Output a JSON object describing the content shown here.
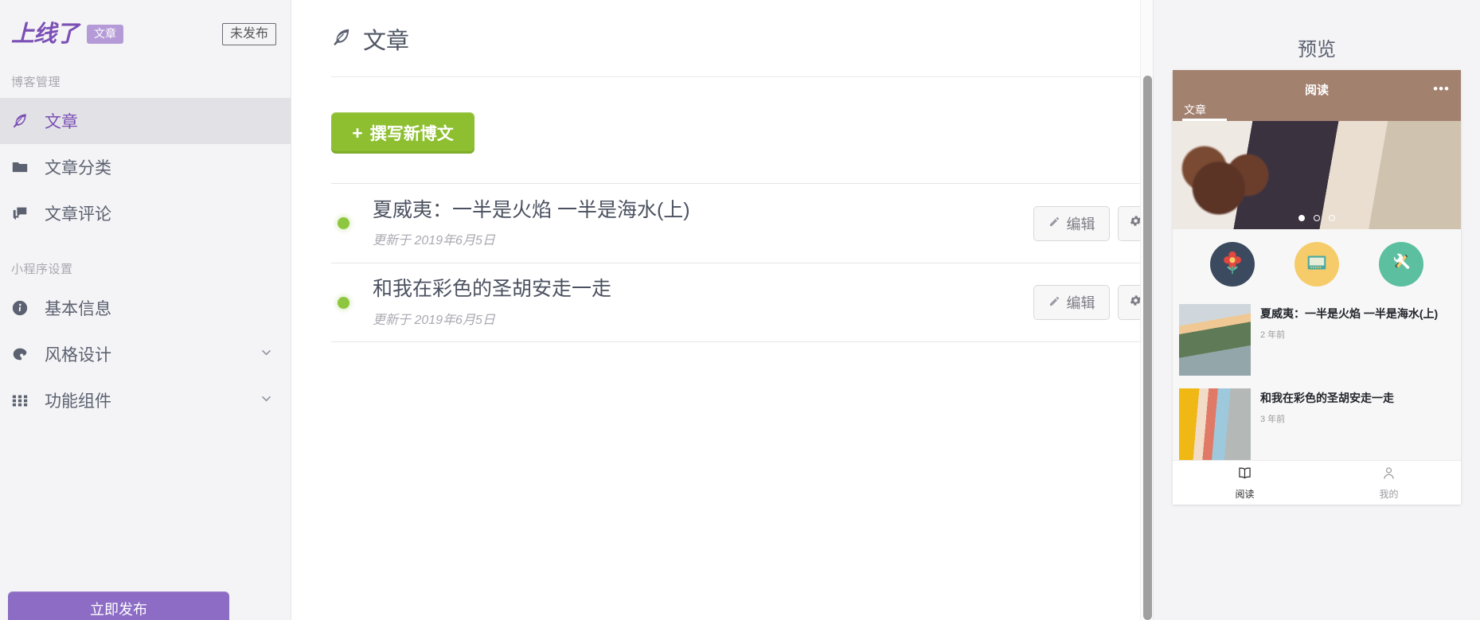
{
  "sidebar": {
    "brand": "上线了",
    "brand_tag": "文章",
    "publish_status": "未发布",
    "groups": [
      {
        "title": "博客管理",
        "items": [
          {
            "label": "文章",
            "icon": "feather-icon",
            "active": true
          },
          {
            "label": "文章分类",
            "icon": "folder-icon",
            "active": false
          },
          {
            "label": "文章评论",
            "icon": "comments-icon",
            "active": false
          }
        ]
      },
      {
        "title": "小程序设置",
        "items": [
          {
            "label": "基本信息",
            "icon": "info-icon",
            "active": false
          },
          {
            "label": "风格设计",
            "icon": "palette-icon",
            "active": false,
            "chevron": "chevron-down-icon"
          },
          {
            "label": "功能组件",
            "icon": "grid-icon",
            "active": false,
            "chevron": "chevron-down-icon"
          }
        ]
      }
    ],
    "bottom_button": "立即发布"
  },
  "main": {
    "page_title": "文章",
    "new_post_button": "撰写新博文",
    "plus": "+",
    "rows": [
      {
        "title": "夏威夷：一半是火焰 一半是海水(上)",
        "subtitle": "更新于 2019年6月5日",
        "edit_label": "编辑",
        "status_color": "#8dc63f"
      },
      {
        "title": "和我在彩色的圣胡安走一走",
        "subtitle": "更新于 2019年6月5日",
        "edit_label": "编辑",
        "status_color": "#8dc63f"
      }
    ]
  },
  "preview": {
    "heading": "预览",
    "phone": {
      "nav_title": "阅读",
      "nav_more": "•••",
      "tab_label": "文章",
      "carousel_dots": 3,
      "carousel_active": 1,
      "shortcuts": [
        {
          "name": "flower-icon",
          "color": "#3b4a5e"
        },
        {
          "name": "monitor-icon",
          "color": "#f6cc6b"
        },
        {
          "name": "tools-icon",
          "color": "#5cbfa0"
        }
      ],
      "articles": [
        {
          "title": "夏威夷：一半是火焰 一半是海水(上)",
          "time": "2 年前"
        },
        {
          "title": "和我在彩色的圣胡安走一走",
          "time": "3 年前"
        }
      ],
      "tabbar": [
        {
          "label": "阅读",
          "icon": "book-icon",
          "active": true
        },
        {
          "label": "我的",
          "icon": "person-icon",
          "active": false
        }
      ]
    }
  },
  "colors": {
    "brand_purple": "#7b4fb5",
    "accent_green": "#8dbf30",
    "status_green": "#8dc63f",
    "phone_nav_brown": "#a3816f"
  }
}
